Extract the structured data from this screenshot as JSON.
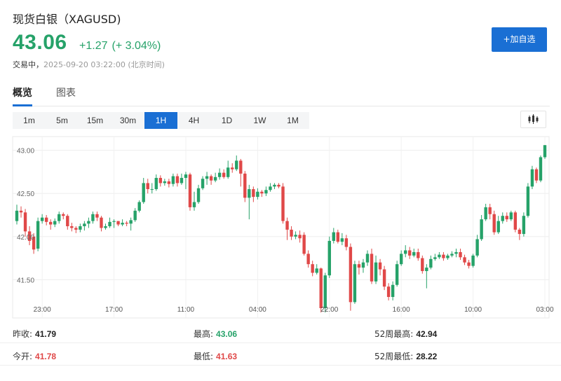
{
  "header": {
    "title": "现货白银（XAGUSD)",
    "price": "43.06",
    "change": "+1.27",
    "change_pct": "(+ 3.04%)",
    "status": "交易中，",
    "timestamp": "2025-09-20 03:22:00",
    "timezone": "(北京时间)",
    "add_watchlist_label": "+加自选"
  },
  "tabs": [
    {
      "label": "概览",
      "active": true
    },
    {
      "label": "图表",
      "active": false
    }
  ],
  "intervals": [
    {
      "label": "1m",
      "active": false
    },
    {
      "label": "5m",
      "active": false
    },
    {
      "label": "15m",
      "active": false
    },
    {
      "label": "30m",
      "active": false
    },
    {
      "label": "1H",
      "active": true
    },
    {
      "label": "4H",
      "active": false
    },
    {
      "label": "1D",
      "active": false
    },
    {
      "label": "1W",
      "active": false
    },
    {
      "label": "1M",
      "active": false
    }
  ],
  "chart_type_icon": "candlestick-icon",
  "colors": {
    "up": "#26a269",
    "down": "#e04848",
    "accent": "#1a6fd4"
  },
  "chart_data": {
    "type": "candlestick",
    "ylim": [
      41.17,
      43.07
    ],
    "yticks": [
      "43.00",
      "42.50",
      "42.00",
      "41.50"
    ],
    "ytick_values": [
      43.0,
      42.5,
      42.0,
      41.5
    ],
    "xticks": [
      "23:00",
      "17:00",
      "11:00",
      "04:00",
      "22:00",
      "16:00",
      "10:00",
      "03:00"
    ],
    "xtick_index": [
      6,
      23,
      40,
      57,
      74,
      91,
      108,
      125
    ],
    "grid": true,
    "candles": [
      [
        42.18,
        42.3,
        42.37,
        42.14
      ],
      [
        42.3,
        42.28,
        42.35,
        42.22
      ],
      [
        42.28,
        42.06,
        42.32,
        42.0
      ],
      [
        42.06,
        41.95,
        42.12,
        41.9
      ],
      [
        42.0,
        41.85,
        42.04,
        41.8
      ],
      [
        41.86,
        42.18,
        42.22,
        41.83
      ],
      [
        42.18,
        42.22,
        42.26,
        42.15
      ],
      [
        42.22,
        42.17,
        42.25,
        42.13
      ],
      [
        42.17,
        42.14,
        42.2,
        42.08
      ],
      [
        42.14,
        42.18,
        42.21,
        42.11
      ],
      [
        42.18,
        42.26,
        42.29,
        42.15
      ],
      [
        42.26,
        42.24,
        42.28,
        42.2
      ],
      [
        42.24,
        42.12,
        42.26,
        42.08
      ],
      [
        42.12,
        42.1,
        42.16,
        42.06
      ],
      [
        42.1,
        42.08,
        42.12,
        42.04
      ],
      [
        42.08,
        42.12,
        42.15,
        42.05
      ],
      [
        42.12,
        42.15,
        42.18,
        42.07
      ],
      [
        42.15,
        42.18,
        42.22,
        42.1
      ],
      [
        42.18,
        42.26,
        42.29,
        42.15
      ],
      [
        42.26,
        42.22,
        42.29,
        42.18
      ],
      [
        42.22,
        42.1,
        42.24,
        42.06
      ],
      [
        42.1,
        42.12,
        42.15,
        42.08
      ],
      [
        42.12,
        42.17,
        42.22,
        42.1
      ],
      [
        42.17,
        42.18,
        42.2,
        42.1
      ],
      [
        42.18,
        42.14,
        42.18,
        42.12
      ],
      [
        42.14,
        42.16,
        42.2,
        42.12
      ],
      [
        42.16,
        42.15,
        42.18,
        42.12
      ],
      [
        42.15,
        42.19,
        42.22,
        42.07
      ],
      [
        42.19,
        42.3,
        42.33,
        42.17
      ],
      [
        42.3,
        42.4,
        42.42,
        42.28
      ],
      [
        42.4,
        42.62,
        42.68,
        42.38
      ],
      [
        42.62,
        42.55,
        42.67,
        42.5
      ],
      [
        42.55,
        42.55,
        42.62,
        42.5
      ],
      [
        42.55,
        42.68,
        42.72,
        42.53
      ],
      [
        42.68,
        42.62,
        42.71,
        42.58
      ],
      [
        42.62,
        42.64,
        42.67,
        42.59
      ],
      [
        42.64,
        42.61,
        42.67,
        42.57
      ],
      [
        42.61,
        42.7,
        42.73,
        42.58
      ],
      [
        42.7,
        42.62,
        42.73,
        42.58
      ],
      [
        42.62,
        42.68,
        42.73,
        42.6
      ],
      [
        42.68,
        42.72,
        42.75,
        42.55
      ],
      [
        42.72,
        42.34,
        42.74,
        42.3
      ],
      [
        42.34,
        42.4,
        42.52,
        42.3
      ],
      [
        42.4,
        42.56,
        42.6,
        42.38
      ],
      [
        42.56,
        42.67,
        42.7,
        42.54
      ],
      [
        42.67,
        42.7,
        42.75,
        42.6
      ],
      [
        42.7,
        42.65,
        42.72,
        42.6
      ],
      [
        42.65,
        42.69,
        42.74,
        42.63
      ],
      [
        42.69,
        42.74,
        42.79,
        42.66
      ],
      [
        42.74,
        42.69,
        42.78,
        42.67
      ],
      [
        42.69,
        42.8,
        42.88,
        42.67
      ],
      [
        42.8,
        42.78,
        42.85,
        42.74
      ],
      [
        42.78,
        42.88,
        42.94,
        42.76
      ],
      [
        42.88,
        42.73,
        42.9,
        42.58
      ],
      [
        42.73,
        42.45,
        42.76,
        42.4
      ],
      [
        42.45,
        42.55,
        42.6,
        42.2
      ],
      [
        42.55,
        42.46,
        42.58,
        42.4
      ],
      [
        42.46,
        42.52,
        42.56,
        42.43
      ],
      [
        42.52,
        42.5,
        42.54,
        42.46
      ],
      [
        42.5,
        42.54,
        42.58,
        42.47
      ],
      [
        42.54,
        42.58,
        42.62,
        42.52
      ],
      [
        42.58,
        42.6,
        42.62,
        42.55
      ],
      [
        42.6,
        42.58,
        42.62,
        42.56
      ],
      [
        42.58,
        42.18,
        42.62,
        42.15
      ],
      [
        42.18,
        42.08,
        42.22,
        41.96
      ],
      [
        42.08,
        42.0,
        42.12,
        41.96
      ],
      [
        42.0,
        42.02,
        42.06,
        41.97
      ],
      [
        42.02,
        41.98,
        42.07,
        41.93
      ],
      [
        42.02,
        41.8,
        42.05,
        41.78
      ],
      [
        41.8,
        41.68,
        41.84,
        41.64
      ],
      [
        41.68,
        41.58,
        41.72,
        41.54
      ],
      [
        41.58,
        41.63,
        41.68,
        41.56
      ],
      [
        41.63,
        41.17,
        41.64,
        41.12
      ],
      [
        41.17,
        41.55,
        41.58,
        41.12
      ],
      [
        41.55,
        41.95,
        42.0,
        41.52
      ],
      [
        41.95,
        42.05,
        42.1,
        41.92
      ],
      [
        42.05,
        41.94,
        42.08,
        41.92
      ],
      [
        41.94,
        41.98,
        42.04,
        41.9
      ],
      [
        41.98,
        41.88,
        42.02,
        41.84
      ],
      [
        41.88,
        41.24,
        41.92,
        41.14
      ],
      [
        41.24,
        41.68,
        41.72,
        41.22
      ],
      [
        41.68,
        41.64,
        41.72,
        41.56
      ],
      [
        41.64,
        41.7,
        41.74,
        41.58
      ],
      [
        41.7,
        41.8,
        41.84,
        41.66
      ],
      [
        41.8,
        41.48,
        41.86,
        41.45
      ],
      [
        41.48,
        41.7,
        41.78,
        41.45
      ],
      [
        41.7,
        41.62,
        41.74,
        41.55
      ],
      [
        41.62,
        41.42,
        41.66,
        41.38
      ],
      [
        41.42,
        41.3,
        41.46,
        41.26
      ],
      [
        41.3,
        41.44,
        41.48,
        41.26
      ],
      [
        41.44,
        41.68,
        41.72,
        41.42
      ],
      [
        41.68,
        41.8,
        41.84,
        41.66
      ],
      [
        41.8,
        41.84,
        41.9,
        41.76
      ],
      [
        41.84,
        41.78,
        41.88,
        41.74
      ],
      [
        41.78,
        41.82,
        41.86,
        41.76
      ],
      [
        41.82,
        41.75,
        41.86,
        41.72
      ],
      [
        41.75,
        41.6,
        41.78,
        41.57
      ],
      [
        41.6,
        41.64,
        41.68,
        41.4
      ],
      [
        41.64,
        41.74,
        41.78,
        41.62
      ],
      [
        41.74,
        41.76,
        41.8,
        41.72
      ],
      [
        41.76,
        41.79,
        41.82,
        41.74
      ],
      [
        41.79,
        41.75,
        41.82,
        41.72
      ],
      [
        41.75,
        41.78,
        41.8,
        41.73
      ],
      [
        41.78,
        41.8,
        41.83,
        41.76
      ],
      [
        41.8,
        41.82,
        41.86,
        41.76
      ],
      [
        41.82,
        41.76,
        41.86,
        41.73
      ],
      [
        41.76,
        41.7,
        41.79,
        41.67
      ],
      [
        41.7,
        41.66,
        41.73,
        41.63
      ],
      [
        41.66,
        41.78,
        41.8,
        41.64
      ],
      [
        41.78,
        41.97,
        42.02,
        41.76
      ],
      [
        41.97,
        42.2,
        42.25,
        41.95
      ],
      [
        42.2,
        42.34,
        42.38,
        42.18
      ],
      [
        42.34,
        42.26,
        42.38,
        42.2
      ],
      [
        42.26,
        42.05,
        42.3,
        42.02
      ],
      [
        42.05,
        42.18,
        42.24,
        42.03
      ],
      [
        42.18,
        42.24,
        42.28,
        42.15
      ],
      [
        42.24,
        42.2,
        42.28,
        42.17
      ],
      [
        42.2,
        42.28,
        42.3,
        42.18
      ],
      [
        42.28,
        42.08,
        42.3,
        42.05
      ],
      [
        42.08,
        42.03,
        42.1,
        41.96
      ],
      [
        42.03,
        42.24,
        42.28,
        42.0
      ],
      [
        42.24,
        42.58,
        42.62,
        42.22
      ],
      [
        42.58,
        42.78,
        42.82,
        42.55
      ],
      [
        42.78,
        42.65,
        42.8,
        42.62
      ],
      [
        42.65,
        42.92,
        42.94,
        42.63
      ],
      [
        42.92,
        43.06,
        43.06,
        42.9
      ]
    ]
  },
  "stats": {
    "prev_close_label": "昨收:",
    "prev_close": "41.79",
    "high_label": "最高:",
    "high": "43.06",
    "high_52w_label": "52周最高:",
    "high_52w": "42.94",
    "open_label": "今开:",
    "open": "41.78",
    "low_label": "最低:",
    "low": "41.63",
    "low_52w_label": "52周最低:",
    "low_52w": "28.22"
  }
}
